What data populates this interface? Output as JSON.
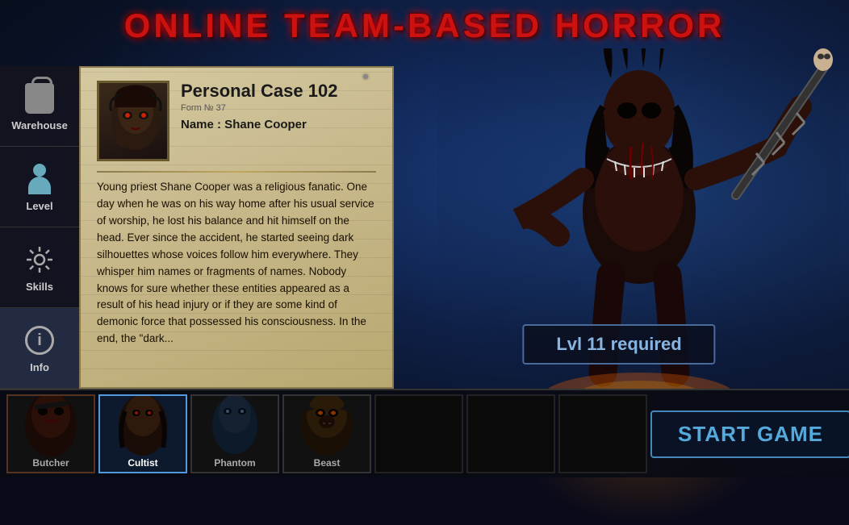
{
  "title": "ONLINE TEAM-BASED HORROR",
  "sidebar": {
    "items": [
      {
        "id": "warehouse",
        "label": "Warehouse",
        "icon": "warehouse-icon"
      },
      {
        "id": "level",
        "label": "Level",
        "icon": "level-icon"
      },
      {
        "id": "skills",
        "label": "Skills",
        "icon": "skills-icon"
      },
      {
        "id": "info",
        "label": "Info",
        "icon": "info-icon",
        "active": true
      }
    ]
  },
  "case_card": {
    "title": "Personal Case 102",
    "form_text": "Form № 37",
    "name_label": "Name : Shane Cooper",
    "description": "Young priest Shane Cooper was a religious fanatic. One day when he was on his way home after his usual service of worship, he lost his balance and hit himself on the head. Ever since the accident, he started seeing dark silhouettes whose voices follow him everywhere. They whisper him names or fragments of names. Nobody knows for sure whether these entities appeared as a result of his head injury or if they are some kind of demonic force that possessed his consciousness. In the end, the \"dark..."
  },
  "monster": {
    "lvl_required_label": "Lvl 11 required"
  },
  "bottom_bar": {
    "characters": [
      {
        "id": "butcher",
        "label": "Butcher",
        "active": false
      },
      {
        "id": "cultist",
        "label": "Cultist",
        "active": true
      },
      {
        "id": "phantom",
        "label": "Phantom",
        "active": false
      },
      {
        "id": "beast",
        "label": "Beast",
        "active": false
      }
    ],
    "empty_slots": 3,
    "start_button_label": "START GAME"
  }
}
